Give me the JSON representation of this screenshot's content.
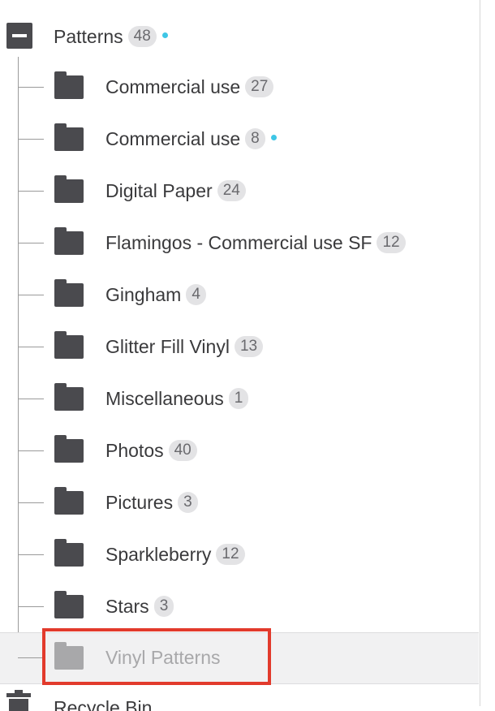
{
  "root": {
    "label": "Patterns",
    "count": "48"
  },
  "items": [
    {
      "label": "Commercial use",
      "count": "27"
    },
    {
      "label": "Commercial use",
      "count": "8"
    },
    {
      "label": "Digital Paper",
      "count": "24"
    },
    {
      "label": "Flamingos - Commercial use SF",
      "count": "12"
    },
    {
      "label": "Gingham",
      "count": "4"
    },
    {
      "label": "Glitter Fill Vinyl",
      "count": "13"
    },
    {
      "label": "Miscellaneous",
      "count": "1"
    },
    {
      "label": "Photos",
      "count": "40"
    },
    {
      "label": "Pictures",
      "count": "3"
    },
    {
      "label": "Sparkleberry",
      "count": "12"
    },
    {
      "label": "Stars",
      "count": "3"
    }
  ],
  "selected_item": {
    "label": "Vinyl Patterns"
  },
  "next_root": {
    "label": "Recycle Bin"
  },
  "colors": {
    "accent_dot": "#3ec6e6",
    "highlight_box": "#e23a2c",
    "icon": "#4a4a4e"
  }
}
